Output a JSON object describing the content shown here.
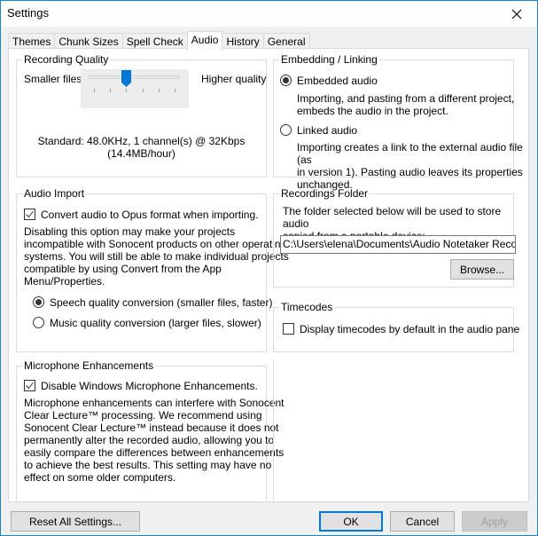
{
  "window": {
    "title": "Settings",
    "close_icon": "close-icon"
  },
  "tabs": [
    {
      "label": "Themes",
      "active": false
    },
    {
      "label": "Chunk Sizes",
      "active": false
    },
    {
      "label": "Spell Check",
      "active": false
    },
    {
      "label": "Audio",
      "active": true
    },
    {
      "label": "History",
      "active": false
    },
    {
      "label": "General",
      "active": false
    }
  ],
  "recording_quality": {
    "title": "Recording Quality",
    "left_label": "Smaller files",
    "right_label": "Higher quality",
    "slider": {
      "ticks": 6,
      "value_index": 2,
      "min_index": 0,
      "max_index": 5
    },
    "description_line1": "Standard: 48.0KHz, 1 channel(s) @ 32Kbps",
    "description_line2": "(14.4MB/hour)"
  },
  "embedding": {
    "title": "Embedding / Linking",
    "options": [
      {
        "label": "Embedded audio",
        "checked": true,
        "description": [
          "Importing, and pasting from a different project,",
          "embeds the audio in the project."
        ]
      },
      {
        "label": "Linked audio",
        "checked": false,
        "description": [
          "Importing creates a link to the external audio file (as",
          "in version 1). Pasting audio leaves its properties",
          "unchanged."
        ]
      }
    ]
  },
  "audio_import": {
    "title": "Audio Import",
    "checkbox_label": "Convert audio to Opus format when importing.",
    "checkbox_checked": true,
    "description": [
      "Disabling this option may make your projects",
      "incompatible with Sonocent products on other operating",
      "systems. You will still be able to make individual projects",
      "compatible by using Convert from the App",
      "Menu/Properties."
    ],
    "options": [
      {
        "label": "Speech quality conversion (smaller files, faster)",
        "checked": true
      },
      {
        "label": "Music quality conversion (larger files, slower)",
        "checked": false
      }
    ]
  },
  "recordings_folder": {
    "title": "Recordings Folder",
    "description": [
      "The folder selected below will be used to store audio",
      "copied from a portable device:"
    ],
    "path_value": "C:\\Users\\elena\\Documents\\Audio Notetaker Recordings",
    "browse_label": "Browse..."
  },
  "timecodes": {
    "title": "Timecodes",
    "checkbox_label": "Display timecodes by default in the audio pane",
    "checkbox_checked": false
  },
  "microphone": {
    "title": "Microphone Enhancements",
    "checkbox_label": "Disable Windows Microphone Enhancements.",
    "checkbox_checked": true,
    "description": [
      "Microphone enhancements can interfere with Sonocent",
      "Clear Lecture™ processing. We recommend using",
      "Sonocent Clear Lecture™ instead because it does not",
      "permanently alter the recorded audio, allowing you to",
      "easily compare the differences between enhancements",
      "to achieve the best results. This setting may have no",
      "effect on some older computers."
    ]
  },
  "footer": {
    "reset_label": "Reset All Settings...",
    "ok_label": "OK",
    "cancel_label": "Cancel",
    "apply_label": "Apply",
    "apply_enabled": false
  },
  "colors": {
    "accent": "#0078d7",
    "window_border": "#1883d7",
    "dialog_bg": "#f0f0f0"
  }
}
